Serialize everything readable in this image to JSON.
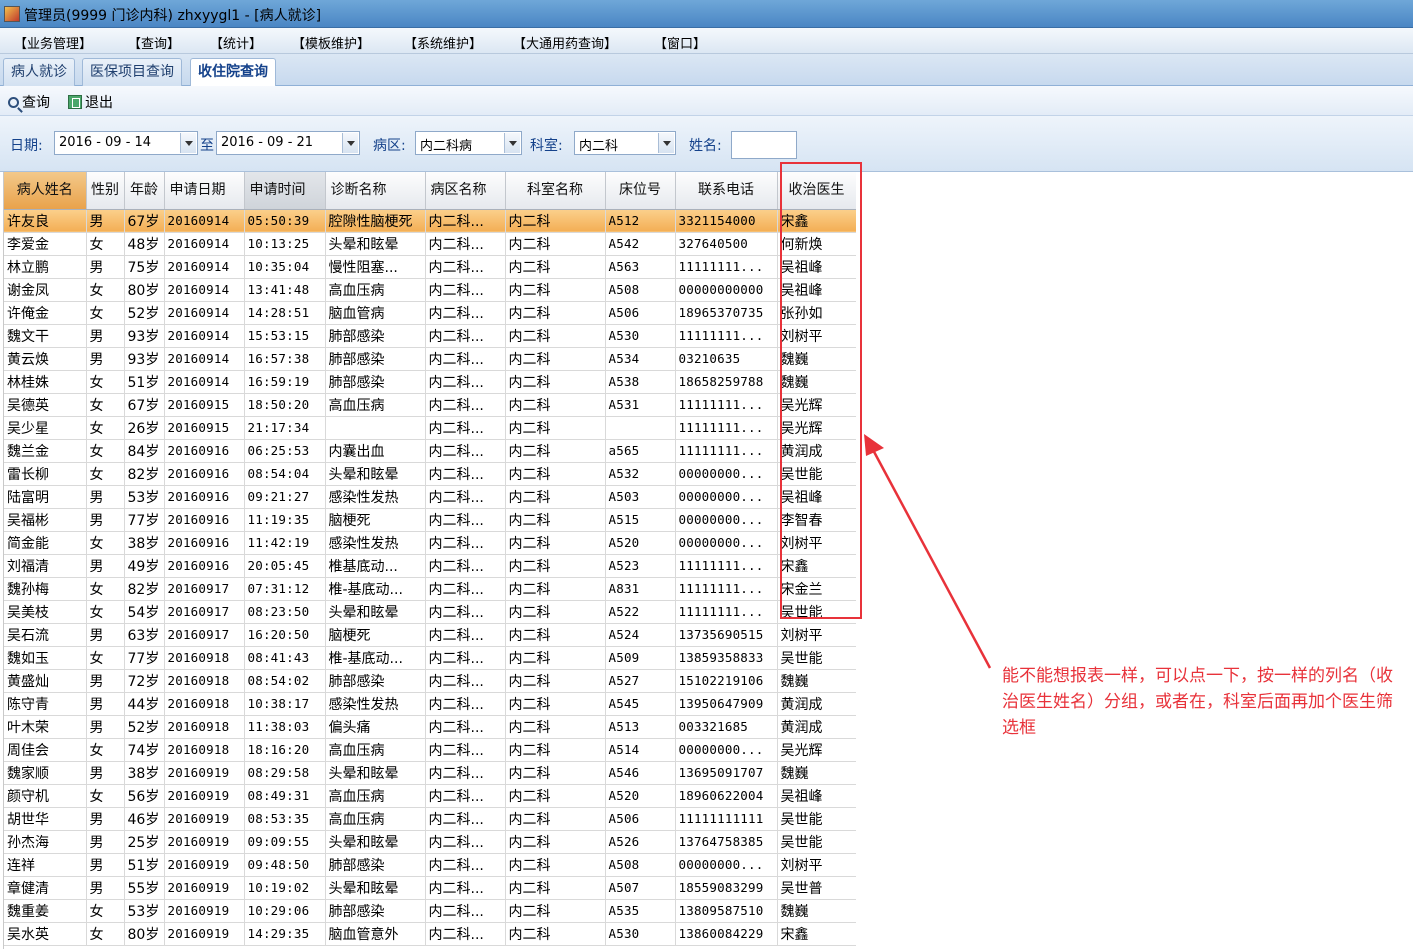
{
  "window": {
    "title": "管理员(9999 门诊内科) zhxyygl1 - [病人就诊]"
  },
  "menu": [
    "【业务管理】",
    "【查询】",
    "【统计】",
    "【模板维护】",
    "【系统维护】",
    "【大通用药查询】",
    "【窗口】"
  ],
  "tabs": [
    "病人就诊",
    "医保项目查询",
    "收住院查询"
  ],
  "active_tab": "收住院查询",
  "toolbar": {
    "query_label": "查询",
    "exit_label": "退出"
  },
  "filters": {
    "date_label": "日期:",
    "date_from": "2016 - 09 - 14",
    "to_label": "至",
    "date_to": "2016 - 09 - 21",
    "ward_label": "病区:",
    "ward_value": "内二科病",
    "dept_label": "科室:",
    "dept_value": "内二科",
    "name_label": "姓名:",
    "name_value": ""
  },
  "table": {
    "columns": [
      "病人姓名",
      "性别",
      "年龄",
      "申请日期",
      "申请时间",
      "诊断名称",
      "病区名称",
      "科室名称",
      "床位号",
      "联系电话",
      "收治医生"
    ],
    "rows": [
      [
        "许友良",
        "男",
        "67岁",
        "20160914",
        "05:50:39",
        "腔隙性脑梗死",
        "内二科...",
        "内二科",
        "A512",
        "3321154000",
        "宋鑫"
      ],
      [
        "李爱金",
        "女",
        "48岁",
        "20160914",
        "10:13:25",
        "头晕和眩晕",
        "内二科...",
        "内二科",
        "A542",
        "327640500",
        "何新焕"
      ],
      [
        "林立鹏",
        "男",
        "75岁",
        "20160914",
        "10:35:04",
        "慢性阻塞...",
        "内二科...",
        "内二科",
        "A563",
        "11111111...",
        "吴祖峰"
      ],
      [
        "谢金凤",
        "女",
        "80岁",
        "20160914",
        "13:41:48",
        "高血压病",
        "内二科...",
        "内二科",
        "A508",
        "00000000000",
        "吴祖峰"
      ],
      [
        "许俺金",
        "女",
        "52岁",
        "20160914",
        "14:28:51",
        "脑血管病",
        "内二科...",
        "内二科",
        "A506",
        "18965370735",
        "张孙如"
      ],
      [
        "魏文干",
        "男",
        "93岁",
        "20160914",
        "15:53:15",
        "肺部感染",
        "内二科...",
        "内二科",
        "A530",
        "11111111...",
        "刘树平"
      ],
      [
        "黄云焕",
        "男",
        "93岁",
        "20160914",
        "16:57:38",
        "肺部感染",
        "内二科...",
        "内二科",
        "A534",
        "03210635",
        "魏巍"
      ],
      [
        "林桂姝",
        "女",
        "51岁",
        "20160914",
        "16:59:19",
        "肺部感染",
        "内二科...",
        "内二科",
        "A538",
        "18658259788",
        "魏巍"
      ],
      [
        "吴德英",
        "女",
        "67岁",
        "20160915",
        "18:50:20",
        "高血压病",
        "内二科...",
        "内二科",
        "A531",
        "11111111...",
        "吴光辉"
      ],
      [
        "吴少星",
        "女",
        "26岁",
        "20160915",
        "21:17:34",
        "",
        "内二科...",
        "内二科",
        "",
        "11111111...",
        "吴光辉"
      ],
      [
        "魏兰金",
        "女",
        "84岁",
        "20160916",
        "06:25:53",
        "内囊出血",
        "内二科...",
        "内二科",
        "a565",
        "11111111...",
        "黄润成"
      ],
      [
        "雷长柳",
        "女",
        "82岁",
        "20160916",
        "08:54:04",
        "头晕和眩晕",
        "内二科...",
        "内二科",
        "A532",
        "00000000...",
        "吴世能"
      ],
      [
        "陆富明",
        "男",
        "53岁",
        "20160916",
        "09:21:27",
        "感染性发热",
        "内二科...",
        "内二科",
        "A503",
        "00000000...",
        "吴祖峰"
      ],
      [
        "吴福彬",
        "男",
        "77岁",
        "20160916",
        "11:19:35",
        "脑梗死",
        "内二科...",
        "内二科",
        "A515",
        "00000000...",
        "李智春"
      ],
      [
        "简金能",
        "女",
        "38岁",
        "20160916",
        "11:42:19",
        "感染性发热",
        "内二科...",
        "内二科",
        "A520",
        "00000000...",
        "刘树平"
      ],
      [
        "刘福清",
        "男",
        "49岁",
        "20160916",
        "20:05:45",
        "椎基底动...",
        "内二科...",
        "内二科",
        "A523",
        "11111111...",
        "宋鑫"
      ],
      [
        "魏孙梅",
        "女",
        "82岁",
        "20160917",
        "07:31:12",
        "椎-基底动...",
        "内二科...",
        "内二科",
        "A831",
        "11111111...",
        "宋金兰"
      ],
      [
        "吴美枝",
        "女",
        "54岁",
        "20160917",
        "08:23:50",
        "头晕和眩晕",
        "内二科...",
        "内二科",
        "A522",
        "11111111...",
        "吴世能"
      ],
      [
        "吴石流",
        "男",
        "63岁",
        "20160917",
        "16:20:50",
        "脑梗死",
        "内二科...",
        "内二科",
        "A524",
        "13735690515",
        "刘树平"
      ],
      [
        "魏如玉",
        "女",
        "77岁",
        "20160918",
        "08:41:43",
        "椎-基底动...",
        "内二科...",
        "内二科",
        "A509",
        "13859358833",
        "吴世能"
      ],
      [
        "黄盛灿",
        "男",
        "72岁",
        "20160918",
        "08:54:02",
        "肺部感染",
        "内二科...",
        "内二科",
        "A527",
        "15102219106",
        "魏巍"
      ],
      [
        "陈守青",
        "男",
        "44岁",
        "20160918",
        "10:38:17",
        "感染性发热",
        "内二科...",
        "内二科",
        "A545",
        "13950647909",
        "黄润成"
      ],
      [
        "叶木荣",
        "男",
        "52岁",
        "20160918",
        "11:38:03",
        "偏头痛",
        "内二科...",
        "内二科",
        "A513",
        "003321685",
        "黄润成"
      ],
      [
        "周佳会",
        "女",
        "74岁",
        "20160918",
        "18:16:20",
        "高血压病",
        "内二科...",
        "内二科",
        "A514",
        "00000000...",
        "吴光辉"
      ],
      [
        "魏家顺",
        "男",
        "38岁",
        "20160919",
        "08:29:58",
        "头晕和眩晕",
        "内二科...",
        "内二科",
        "A546",
        "13695091707",
        "魏巍"
      ],
      [
        "颜守机",
        "女",
        "56岁",
        "20160919",
        "08:49:31",
        "高血压病",
        "内二科...",
        "内二科",
        "A520",
        "18960622004",
        "吴祖峰"
      ],
      [
        "胡世华",
        "男",
        "46岁",
        "20160919",
        "08:53:35",
        "高血压病",
        "内二科...",
        "内二科",
        "A506",
        "11111111111",
        "吴世能"
      ],
      [
        "孙杰海",
        "男",
        "25岁",
        "20160919",
        "09:09:55",
        "头晕和眩晕",
        "内二科...",
        "内二科",
        "A526",
        "13764758385",
        "吴世能"
      ],
      [
        "连祥",
        "男",
        "51岁",
        "20160919",
        "09:48:50",
        "肺部感染",
        "内二科...",
        "内二科",
        "A508",
        "00000000...",
        "刘树平"
      ],
      [
        "章健清",
        "男",
        "55岁",
        "20160919",
        "10:19:02",
        "头晕和眩晕",
        "内二科...",
        "内二科",
        "A507",
        "18559083299",
        "吴世普"
      ],
      [
        "魏重姜",
        "女",
        "53岁",
        "20160919",
        "10:29:06",
        "肺部感染",
        "内二科...",
        "内二科",
        "A535",
        "13809587510",
        "魏巍"
      ],
      [
        "吴水英",
        "女",
        "80岁",
        "20160919",
        "14:29:35",
        "脑血管意外",
        "内二科...",
        "内二科",
        "A530",
        "13860084229",
        "宋鑫"
      ]
    ],
    "selected_row": 0
  },
  "annotation": {
    "text": "能不能想报表一样，可以点一下，按一样的列名（收治医生姓名）分组，或者在，科室后面再加个医生筛选框",
    "color": "#e8323a"
  }
}
